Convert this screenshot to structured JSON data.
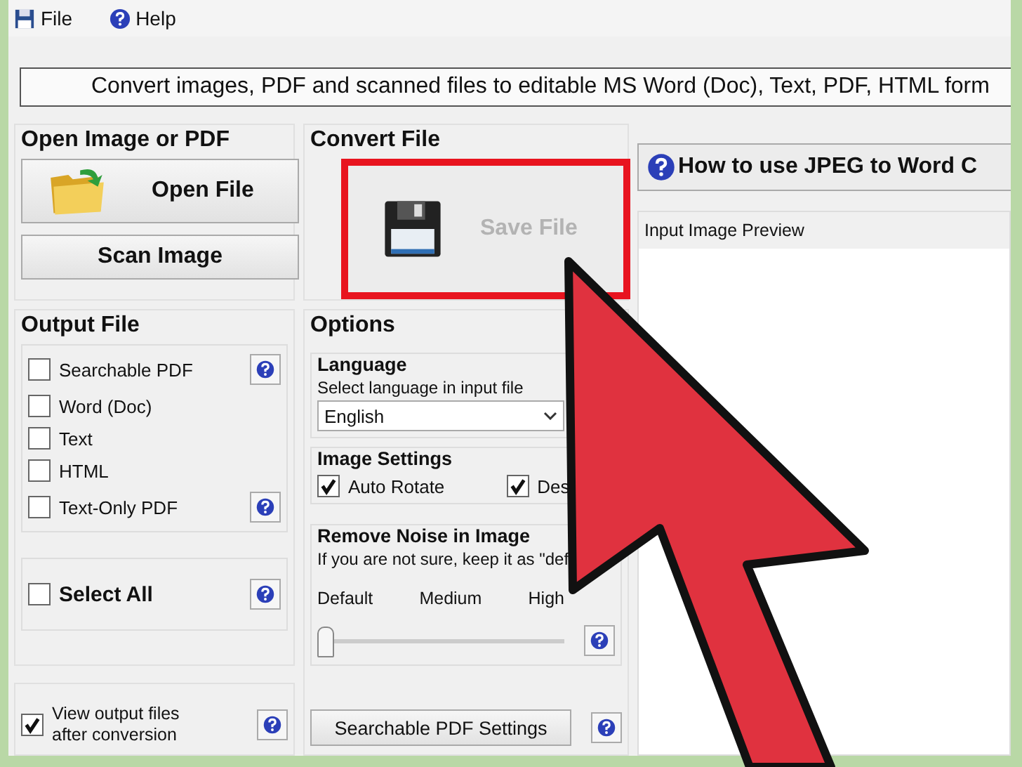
{
  "menu": [
    {
      "label": "File"
    },
    {
      "label": "Help"
    }
  ],
  "banner": "Convert images, PDF and scanned files to editable MS Word (Doc), Text, PDF, HTML form",
  "open_group": {
    "title": "Open Image or PDF",
    "buttons": [
      {
        "label": "Open File"
      },
      {
        "label": "Scan Image"
      }
    ]
  },
  "convert_group": {
    "title": "Convert File",
    "save_button": {
      "label": "Save File",
      "disabled": true,
      "highlighted": true
    }
  },
  "output_group": {
    "title": "Output File",
    "formats": [
      {
        "label": "Searchable PDF",
        "checked": false,
        "help": true
      },
      {
        "label": "Word (Doc)",
        "checked": false,
        "help": false
      },
      {
        "label": "Text",
        "checked": false,
        "help": false
      },
      {
        "label": "HTML",
        "checked": false,
        "help": false
      },
      {
        "label": "Text-Only PDF",
        "checked": false,
        "help": true
      }
    ],
    "select_all": {
      "label": "Select All",
      "checked": false
    },
    "view_output": {
      "label": "View output files after conversion",
      "checked": true
    }
  },
  "options": {
    "title": "Options",
    "language": {
      "title": "Language",
      "hint": "Select language in input file",
      "value": "English"
    },
    "image_settings": {
      "title": "Image Settings",
      "items": [
        {
          "label": "Auto Rotate",
          "checked": true
        },
        {
          "label": "Des",
          "checked": true
        }
      ]
    },
    "noise": {
      "title": "Remove Noise in Image",
      "hint": "If you are not sure, keep it as \"def",
      "ticks": [
        "Default",
        "Medium",
        "High"
      ],
      "level": 0
    },
    "pdf_settings_button": "Searchable PDF Settings"
  },
  "help_header": "How to use JPEG to Word C",
  "preview": {
    "title": "Input Image Preview"
  },
  "annotation": {
    "arrow": true
  }
}
